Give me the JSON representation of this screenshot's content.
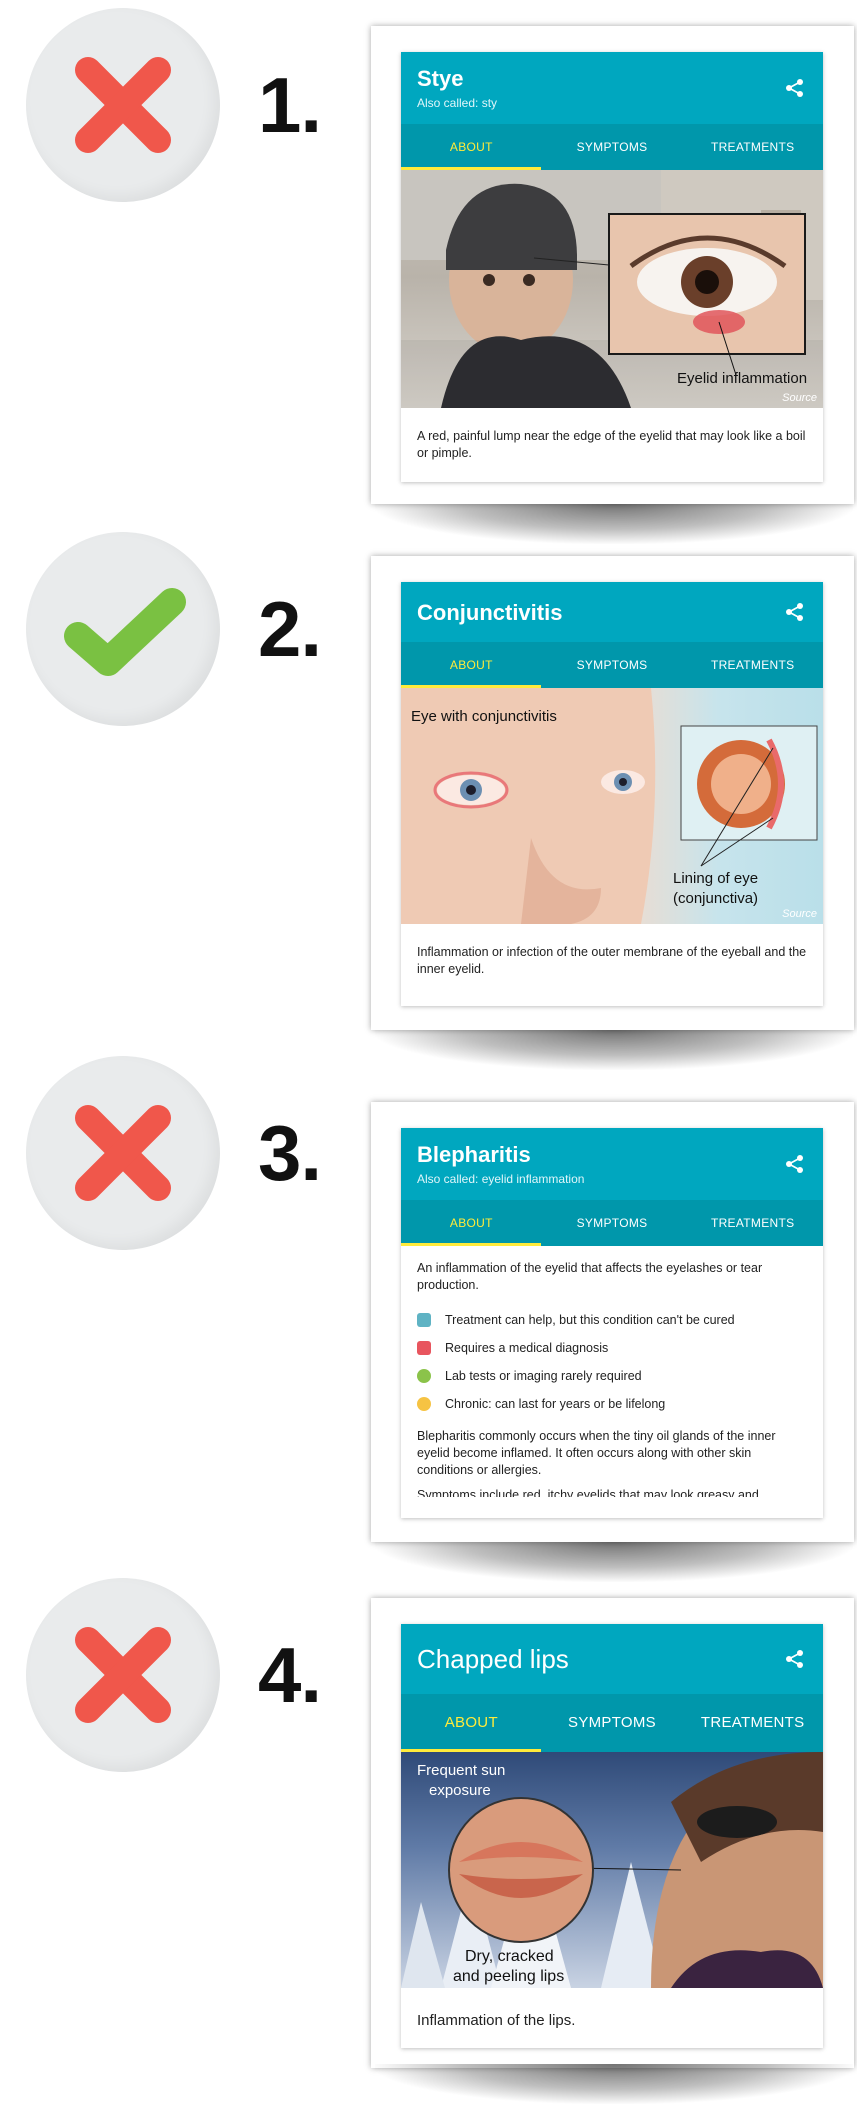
{
  "items": [
    {
      "number": "1.",
      "verdict": "cross",
      "title": "Stye",
      "also_called": "Also called: sty",
      "tabs": [
        "ABOUT",
        "SYMPTOMS",
        "TREATMENTS"
      ],
      "image_caption": "Eyelid inflammation",
      "source_label": "Source",
      "description": "A red, painful lump near the edge of the eyelid that may look like a boil or pimple."
    },
    {
      "number": "2.",
      "verdict": "check",
      "title": "Conjunctivitis",
      "tabs": [
        "ABOUT",
        "SYMPTOMS",
        "TREATMENTS"
      ],
      "image_label_top": "Eye with conjunctivitis",
      "image_label_bottom_1": "Lining of eye",
      "image_label_bottom_2": "(conjunctiva)",
      "source_label": "Source",
      "description": "Inflammation or infection of the outer membrane of the eyeball and the inner eyelid."
    },
    {
      "number": "3.",
      "verdict": "cross",
      "title": "Blepharitis",
      "also_called": "Also called: eyelid inflammation",
      "tabs": [
        "ABOUT",
        "SYMPTOMS",
        "TREATMENTS"
      ],
      "description": "An inflammation of the eyelid that affects the eyelashes or tear production.",
      "facts": [
        {
          "text": "Treatment can help, but this condition can't be cured",
          "icon": "medicine-bottle-icon",
          "color": "#5fb3c4"
        },
        {
          "text": "Requires a medical diagnosis",
          "icon": "clipboard-icon",
          "color": "#e8555e"
        },
        {
          "text": "Lab tests or imaging rarely required",
          "icon": "lab-test-icon",
          "color": "#8bc34a"
        },
        {
          "text": "Chronic: can last for years or be lifelong",
          "icon": "clock-icon",
          "color": "#f6c343"
        }
      ],
      "detail_1": "Blepharitis commonly occurs when the tiny oil glands of the inner eyelid become inflamed. It often occurs along with other skin conditions or allergies.",
      "detail_2": "Symptoms include red, itchy eyelids that may look greasy and"
    },
    {
      "number": "4.",
      "verdict": "cross",
      "title": "Chapped lips",
      "tabs": [
        "ABOUT",
        "SYMPTOMS",
        "TREATMENTS"
      ],
      "image_label_top_1": "Frequent sun",
      "image_label_top_2": "exposure",
      "image_label_bottom_1": "Dry, cracked",
      "image_label_bottom_2": "and peeling lips",
      "description": "Inflammation of the lips."
    }
  ],
  "colors": {
    "header": "#00a7bf",
    "tabs": "#0097ab",
    "active_tab": "#ffeb3b",
    "cross": "#f0574b",
    "check": "#7ac142"
  }
}
